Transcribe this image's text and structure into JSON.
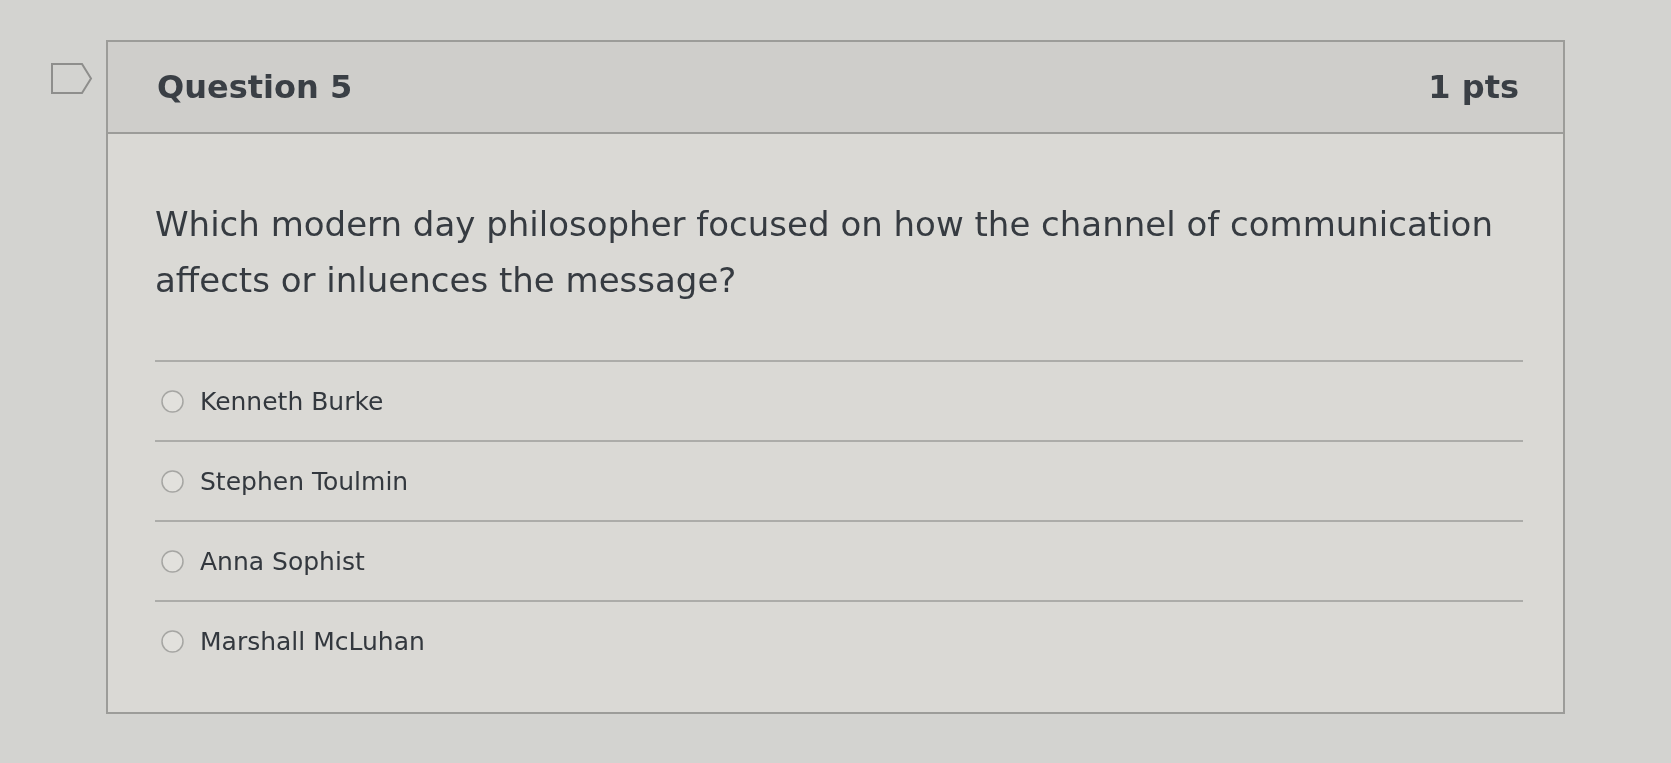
{
  "question": {
    "title": "Question 5",
    "points": "1 pts",
    "text": "Which modern day philosopher focused on how the channel of communication affects or inluences the message?",
    "answers": [
      {
        "label": "Kenneth Burke",
        "selected": false
      },
      {
        "label": "Stephen Toulmin",
        "selected": false
      },
      {
        "label": "Anna Sophist",
        "selected": false
      },
      {
        "label": "Marshall McLuhan",
        "selected": false
      }
    ]
  }
}
